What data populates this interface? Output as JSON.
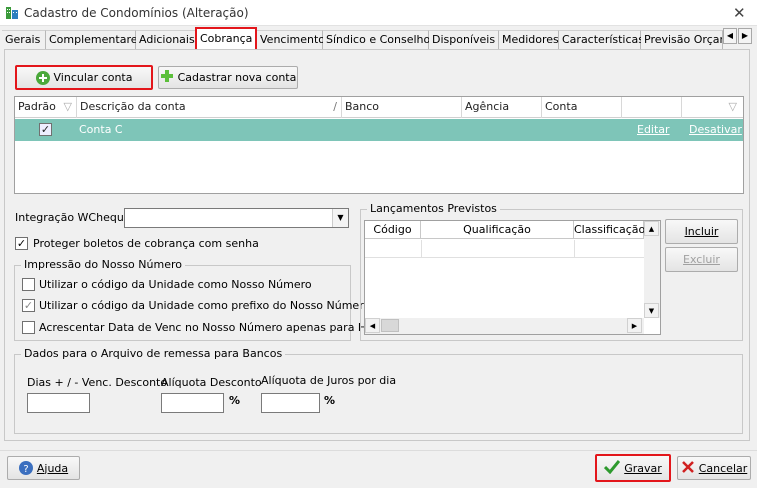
{
  "window": {
    "title": "Cadastro de Condomínios (Alteração)"
  },
  "tabs": [
    {
      "label": "Gerais"
    },
    {
      "label": "Complementares"
    },
    {
      "label": "Adicionais"
    },
    {
      "label": "Cobrança"
    },
    {
      "label": "Vencimento"
    },
    {
      "label": "Síndico e Conselho"
    },
    {
      "label": "Disponíveis"
    },
    {
      "label": "Medidores"
    },
    {
      "label": "Características"
    },
    {
      "label": "Previsão Orçam"
    }
  ],
  "toolbar": {
    "vincular_label": "Vincular conta",
    "cadastrar_label": "Cadastrar nova conta"
  },
  "accounts_grid": {
    "columns": [
      "Padrão",
      "Descrição da conta",
      "Banco",
      "Agência",
      "Conta"
    ],
    "rows": [
      {
        "checked": true,
        "descricao": "Conta C",
        "edit": "Editar",
        "disable": "Desativar"
      }
    ]
  },
  "form": {
    "integracao_label": "Integração WCheque",
    "proteger_label": "Proteger boletos de cobrança com senha",
    "impressao_group": "Impressão do Nosso Número",
    "opt1": "Utilizar o código da Unidade como Nosso Número",
    "opt2": "Utilizar o código da Unidade como prefixo do Nosso Número",
    "opt3": "Acrescentar Data de Venc no Nosso Número apenas para HSBC",
    "lancamentos_group": "Lançamentos Previstos",
    "lanc_columns": [
      "Código",
      "Qualificação",
      "Classificação"
    ],
    "incluir_label": "Incluir",
    "excluir_label": "Excluir",
    "remessa_group": "Dados para o Arquivo de remessa para Bancos",
    "dias_label": "Dias + / - Venc. Desconto",
    "aliquota_desc_label": "Alíquota Desconto",
    "aliquota_juros_label": "Alíquota de Juros por dia",
    "percent": "%"
  },
  "footer": {
    "ajuda_label": "Ajuda",
    "gravar_label": "Gravar",
    "cancelar_label": "Cancelar"
  }
}
